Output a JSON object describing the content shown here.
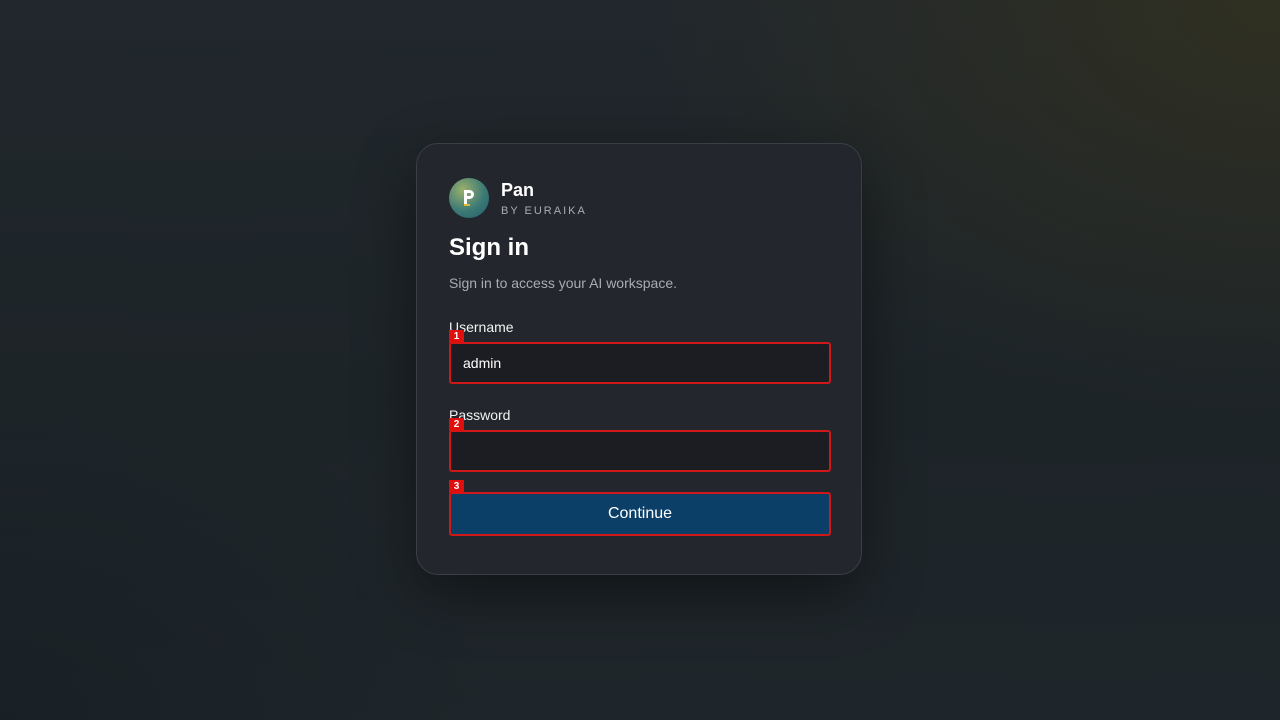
{
  "brand": {
    "name": "Pan",
    "subtitle": "BY EURAIKA",
    "logo_icon": "pan-logo-icon"
  },
  "heading": {
    "title": "Sign in",
    "subtitle": "Sign in to access your AI workspace."
  },
  "form": {
    "username": {
      "label": "Username",
      "value": "admin",
      "marker": "1"
    },
    "password": {
      "label": "Password",
      "value": "",
      "marker": "2"
    },
    "submit": {
      "label": "Continue",
      "marker": "3"
    }
  },
  "colors": {
    "card_background": "#23262d",
    "button_background": "#0b3f68",
    "highlight_border": "#d01818",
    "marker_background": "#e10e0e"
  }
}
